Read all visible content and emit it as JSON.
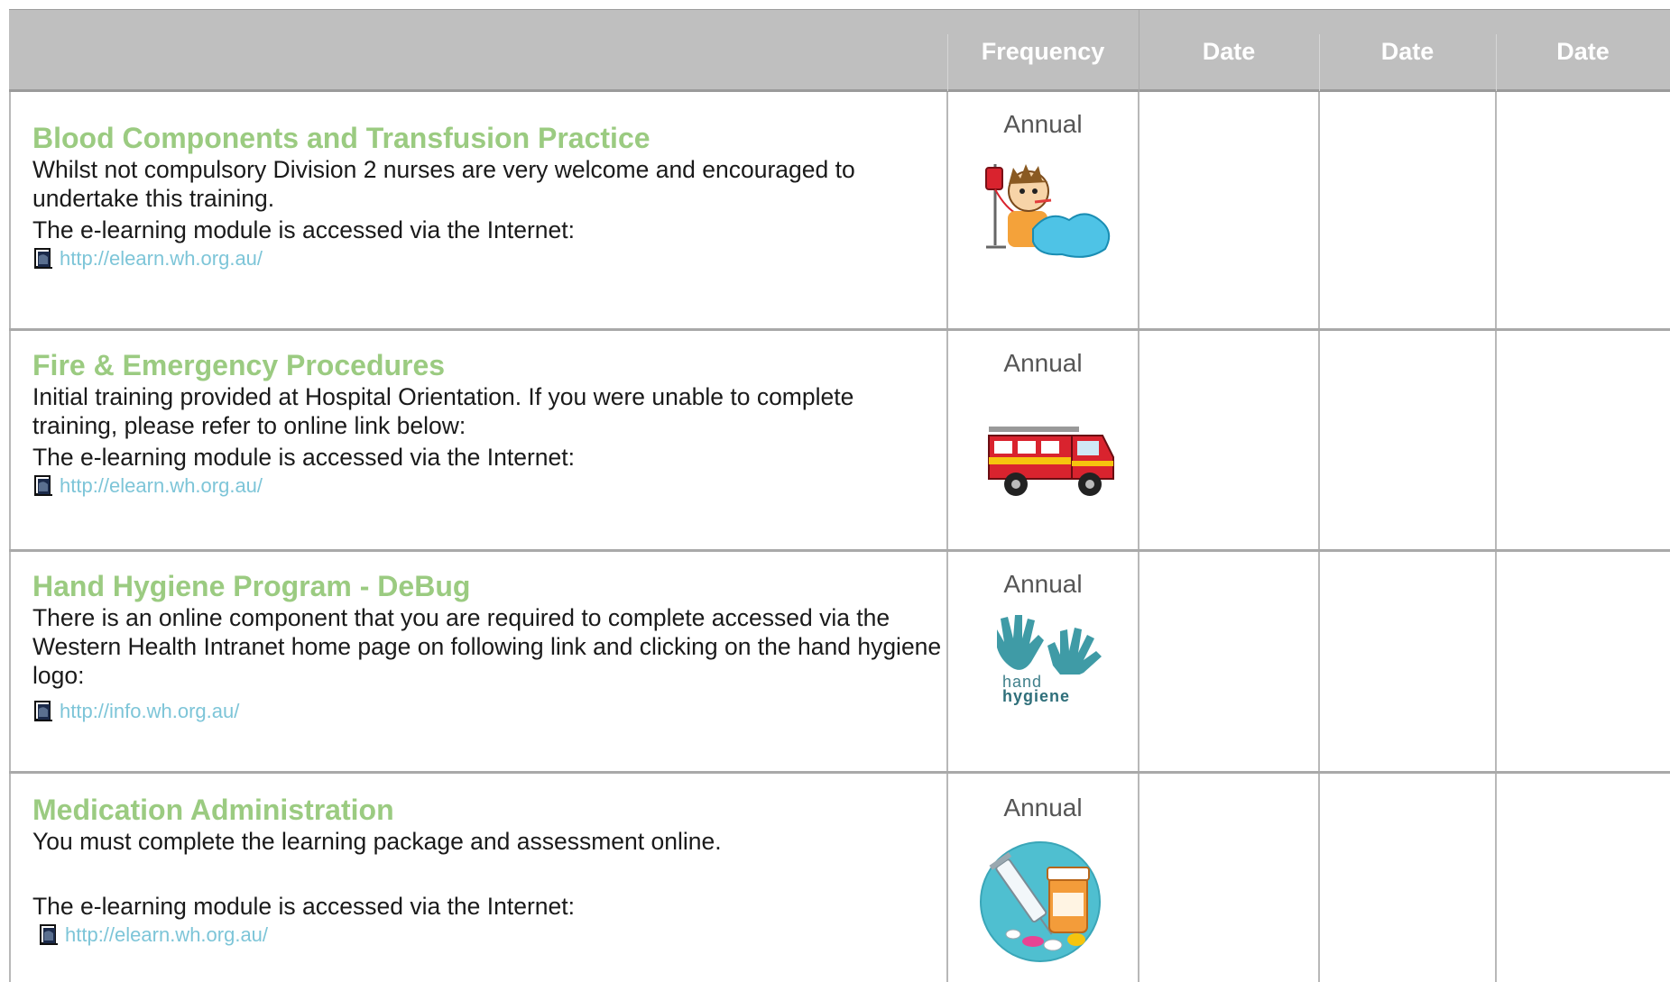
{
  "header": {
    "columns": [
      "Frequency",
      "Date",
      "Date",
      "Date"
    ]
  },
  "rows": [
    {
      "title": "Blood Components and Transfusion Practice",
      "description": "Whilst not compulsory Division 2 nurses are very welcome and encouraged to undertake this training.",
      "lead": "The e-learning module is accessed via the Internet:",
      "link": "http://elearn.wh.org.au/",
      "frequency": "Annual",
      "icon": "transfusion-patient-icon"
    },
    {
      "title": "Fire & Emergency Procedures",
      "description": "Initial training provided at Hospital Orientation. If you were unable to complete training, please refer to online link below:",
      "lead": "The e-learning module is accessed via the Internet:",
      "link": "http://elearn.wh.org.au/",
      "frequency": "Annual",
      "icon": "fire-truck-icon"
    },
    {
      "title": "Hand Hygiene Program - DeBug",
      "description": "There is an online component that you are required to complete accessed via the Western Health Intranet home page on following link and clicking on the  hand hygiene logo:",
      "link": "http://info.wh.org.au/",
      "frequency": "Annual",
      "icon": "hand-hygiene-logo",
      "logo_text_1": "hand",
      "logo_text_2": "hygiene"
    },
    {
      "title": "Medication Administration",
      "description": "You must complete the learning package and assessment online.",
      "lead": "The e-learning module is accessed via the Internet:",
      "link": "http://elearn.wh.org.au/",
      "frequency": "Annual",
      "icon": "medication-icon"
    }
  ],
  "colors": {
    "header_bg": "#bfbfbf",
    "title_green": "#9bcb81",
    "link_blue": "#7dc5d8"
  }
}
